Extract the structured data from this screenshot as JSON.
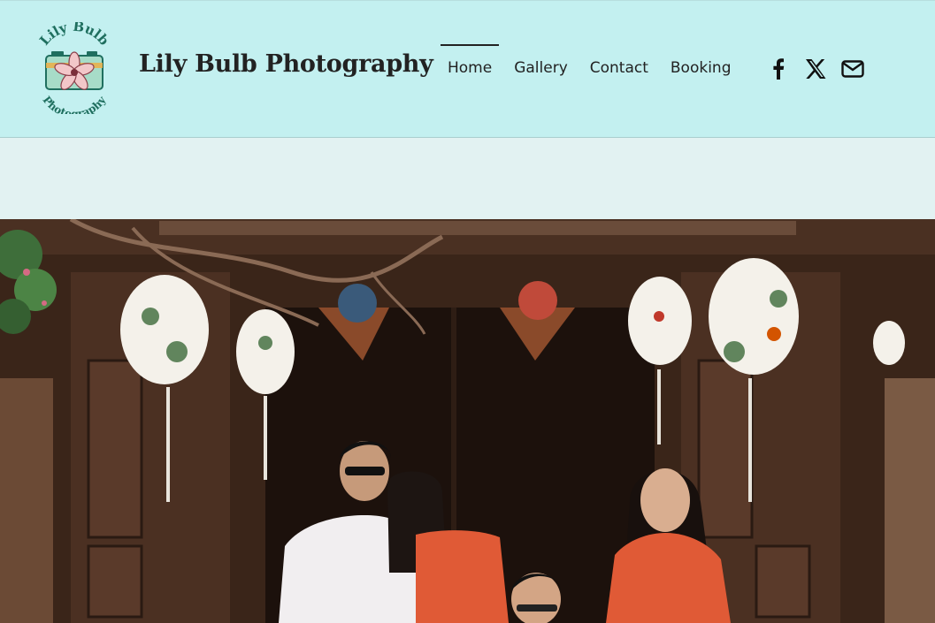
{
  "site": {
    "title": "Lily Bulb Photography",
    "logo_text_top": "Lily Bulb",
    "logo_text_bottom": "Photography"
  },
  "nav": {
    "items": [
      {
        "label": "Home",
        "active": true
      },
      {
        "label": "Gallery",
        "active": false
      },
      {
        "label": "Contact",
        "active": false
      },
      {
        "label": "Booking",
        "active": false
      }
    ]
  },
  "social": [
    {
      "icon": "facebook-icon"
    },
    {
      "icon": "x-twitter-icon"
    },
    {
      "icon": "email-icon"
    }
  ],
  "colors": {
    "header_bg": "#c3f0f0",
    "band_bg": "#e2f2f2",
    "text": "#222222",
    "logo_green": "#1f6f5f",
    "lantern_white": "#f4f1ea",
    "dress_orange": "#e05a36"
  },
  "hero": {
    "description_icon": "family-photo-hero"
  }
}
